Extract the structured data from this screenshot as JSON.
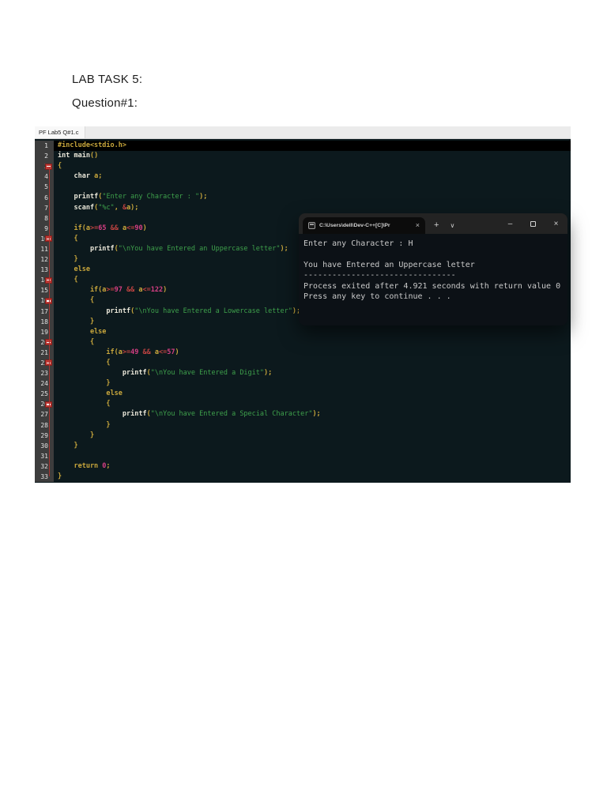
{
  "page": {
    "heading1": "LAB TASK 5:",
    "heading2": "Question#1:"
  },
  "editor": {
    "tab_label": "PF Lab5 Q#1.c",
    "colors": {
      "background": "#0c191d",
      "gutter": "#3d3d3d",
      "keyword_punct": "#c9a73c",
      "type_function": "#ebe8da",
      "string": "#3ea04b",
      "number": "#d63f84",
      "operator": "#bf4341",
      "fold_marker": "#c23a35",
      "line1_highlight": "#000000"
    },
    "lines": [
      {
        "n": 1,
        "hl": true,
        "t": [
          [
            "y",
            "#include<stdio.h>"
          ]
        ]
      },
      {
        "n": 2,
        "t": [
          [
            "w",
            "int main"
          ],
          [
            "y",
            "()"
          ]
        ]
      },
      {
        "n": 3,
        "fold": true,
        "t": [
          [
            "y",
            "{"
          ]
        ]
      },
      {
        "n": 4,
        "t": [
          [
            "y",
            "    "
          ],
          [
            "w",
            "char"
          ],
          [
            "y",
            " a;"
          ]
        ]
      },
      {
        "n": 5,
        "t": []
      },
      {
        "n": 6,
        "t": [
          [
            "y",
            "    "
          ],
          [
            "w",
            "printf"
          ],
          [
            "y",
            "("
          ],
          [
            "s",
            "\"Enter any Character : \""
          ],
          [
            "y",
            ");"
          ]
        ]
      },
      {
        "n": 7,
        "t": [
          [
            "y",
            "    "
          ],
          [
            "w",
            "scanf"
          ],
          [
            "y",
            "("
          ],
          [
            "s",
            "\"%c\""
          ],
          [
            "y",
            ", "
          ],
          [
            "o",
            "&"
          ],
          [
            "y",
            "a);"
          ]
        ]
      },
      {
        "n": 8,
        "t": []
      },
      {
        "n": 9,
        "t": [
          [
            "y",
            "    if(a"
          ],
          [
            "o",
            ">="
          ],
          [
            "num",
            "65"
          ],
          [
            "y",
            " "
          ],
          [
            "o",
            "&&"
          ],
          [
            "y",
            " a"
          ],
          [
            "o",
            "<="
          ],
          [
            "num",
            "90"
          ],
          [
            "y",
            ")"
          ]
        ]
      },
      {
        "n": 10,
        "fold": true,
        "t": [
          [
            "y",
            "    {"
          ]
        ]
      },
      {
        "n": 11,
        "t": [
          [
            "y",
            "        "
          ],
          [
            "w",
            "printf"
          ],
          [
            "y",
            "("
          ],
          [
            "s",
            "\"\\nYou have Entered an Uppercase letter\""
          ],
          [
            "y",
            ");"
          ]
        ]
      },
      {
        "n": 12,
        "t": [
          [
            "y",
            "    }"
          ]
        ]
      },
      {
        "n": 13,
        "t": [
          [
            "y",
            "    else"
          ]
        ]
      },
      {
        "n": 14,
        "fold": true,
        "t": [
          [
            "y",
            "    {"
          ]
        ]
      },
      {
        "n": 15,
        "t": [
          [
            "y",
            "        if(a"
          ],
          [
            "o",
            ">="
          ],
          [
            "num",
            "97"
          ],
          [
            "y",
            " "
          ],
          [
            "o",
            "&&"
          ],
          [
            "y",
            " a"
          ],
          [
            "o",
            "<="
          ],
          [
            "num",
            "122"
          ],
          [
            "y",
            ")"
          ]
        ]
      },
      {
        "n": 16,
        "fold": true,
        "t": [
          [
            "y",
            "        {"
          ]
        ]
      },
      {
        "n": 17,
        "t": [
          [
            "y",
            "            "
          ],
          [
            "w",
            "printf"
          ],
          [
            "y",
            "("
          ],
          [
            "s",
            "\"\\nYou have Entered a Lowercase letter\""
          ],
          [
            "y",
            ");"
          ]
        ]
      },
      {
        "n": 18,
        "t": [
          [
            "y",
            "        }"
          ]
        ]
      },
      {
        "n": 19,
        "t": [
          [
            "y",
            "        else"
          ]
        ]
      },
      {
        "n": 20,
        "fold": true,
        "t": [
          [
            "y",
            "        {"
          ]
        ]
      },
      {
        "n": 21,
        "t": [
          [
            "y",
            "            if(a"
          ],
          [
            "o",
            ">="
          ],
          [
            "num",
            "49"
          ],
          [
            "y",
            " "
          ],
          [
            "o",
            "&&"
          ],
          [
            "y",
            " a"
          ],
          [
            "o",
            "<="
          ],
          [
            "num",
            "57"
          ],
          [
            "y",
            ")"
          ]
        ]
      },
      {
        "n": 22,
        "fold": true,
        "t": [
          [
            "y",
            "            {"
          ]
        ]
      },
      {
        "n": 23,
        "t": [
          [
            "y",
            "                "
          ],
          [
            "w",
            "printf"
          ],
          [
            "y",
            "("
          ],
          [
            "s",
            "\"\\nYou have Entered a Digit\""
          ],
          [
            "y",
            ");"
          ]
        ]
      },
      {
        "n": 24,
        "t": [
          [
            "y",
            "            }"
          ]
        ]
      },
      {
        "n": 25,
        "t": [
          [
            "y",
            "            else"
          ]
        ]
      },
      {
        "n": 26,
        "fold": true,
        "t": [
          [
            "y",
            "            {"
          ]
        ]
      },
      {
        "n": 27,
        "t": [
          [
            "y",
            "                "
          ],
          [
            "w",
            "printf"
          ],
          [
            "y",
            "("
          ],
          [
            "s",
            "\"\\nYou have Entered a Special Character\""
          ],
          [
            "y",
            ");"
          ]
        ]
      },
      {
        "n": 28,
        "t": [
          [
            "y",
            "            }"
          ]
        ]
      },
      {
        "n": 29,
        "t": [
          [
            "y",
            "        }"
          ]
        ]
      },
      {
        "n": 30,
        "t": [
          [
            "y",
            "    }"
          ]
        ]
      },
      {
        "n": 31,
        "t": []
      },
      {
        "n": 32,
        "t": [
          [
            "y",
            "    return "
          ],
          [
            "num",
            "0"
          ],
          [
            "y",
            ";"
          ]
        ]
      },
      {
        "n": 33,
        "t": [
          [
            "y",
            "}"
          ]
        ]
      }
    ]
  },
  "console": {
    "tab_title": "C:\\Users\\dell\\Dev-C++[C]\\Pr",
    "tab_close_glyph": "×",
    "new_tab_glyph": "+",
    "dropdown_glyph": "∨",
    "minimize_glyph": "–",
    "close_glyph": "×",
    "lines": [
      "Enter any Character : H",
      " ",
      "You have Entered an Uppercase letter",
      "--------------------------------",
      "Process exited after 4.921 seconds with return value 0",
      "Press any key to continue . . ."
    ]
  }
}
